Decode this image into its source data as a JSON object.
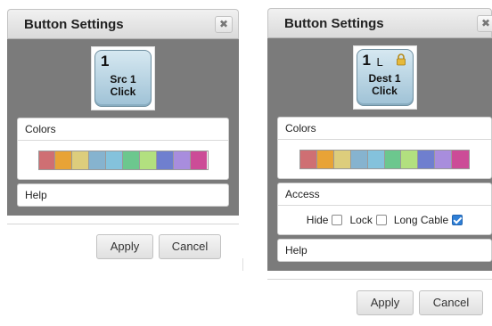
{
  "dialogs": [
    {
      "title": "Button Settings",
      "close_icon": "close-icon",
      "button_key": {
        "number": "1",
        "line1": "Src 1",
        "line2": "Click"
      },
      "colors_label": "Colors",
      "help_label": "Help",
      "apply_label": "Apply",
      "cancel_label": "Cancel"
    },
    {
      "title": "Button Settings",
      "close_icon": "close-icon",
      "button_key": {
        "number": "1",
        "suffix": "L",
        "lock_icon": "lock-icon",
        "line1": "Dest 1",
        "line2": "Click"
      },
      "colors_label": "Colors",
      "access_label": "Access",
      "access": {
        "hide_label": "Hide",
        "hide_checked": false,
        "lock_label": "Lock",
        "lock_checked": false,
        "long_cable_label": "Long Cable",
        "long_cable_checked": true
      },
      "help_label": "Help",
      "apply_label": "Apply",
      "cancel_label": "Cancel"
    }
  ],
  "palette": [
    "#cf6f73",
    "#e8a336",
    "#ddcd7c",
    "#86b3cf",
    "#84c2dc",
    "#6cc78e",
    "#b2e07f",
    "#6f7fcf",
    "#a88ddd",
    "#cc4c97"
  ]
}
